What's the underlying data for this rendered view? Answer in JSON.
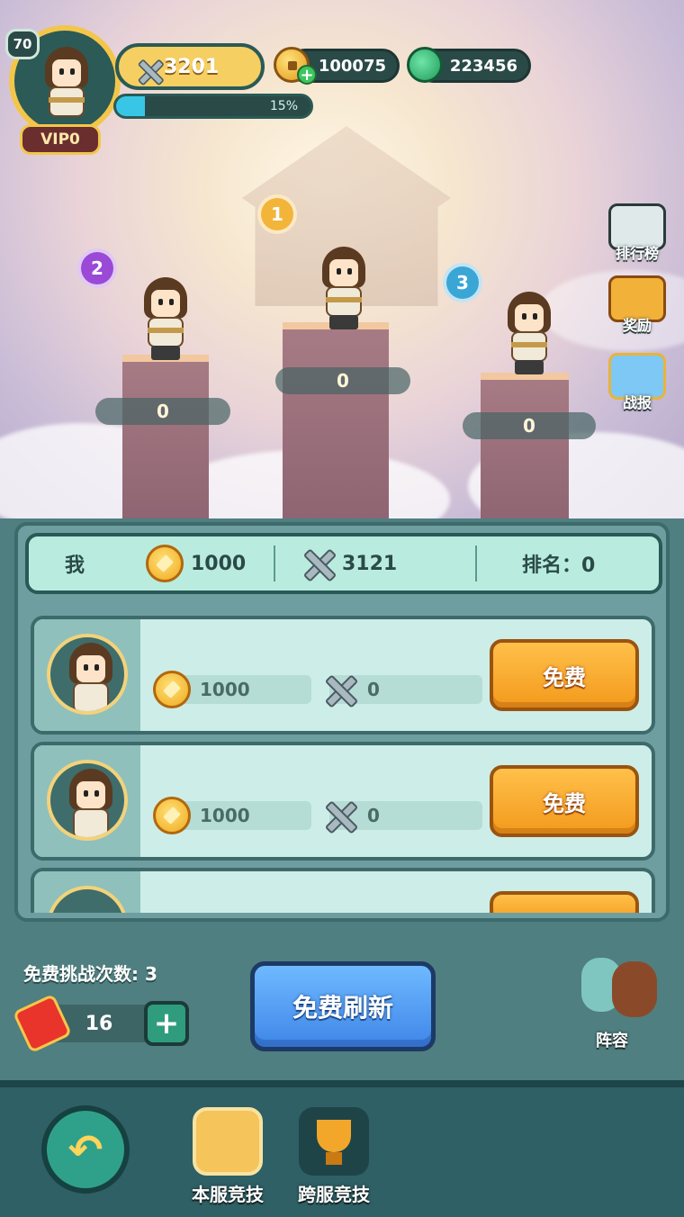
{
  "player": {
    "level": "70",
    "vip": "VIP0",
    "power": "3201",
    "exp_percent": 15,
    "exp_label": "15%",
    "coins": "100075",
    "jade": "223456"
  },
  "podium": [
    {
      "rank": "1",
      "score": "0",
      "badge_color": "#f3b43a"
    },
    {
      "rank": "2",
      "score": "0",
      "badge_color": "#9a4ad6"
    },
    {
      "rank": "3",
      "score": "0",
      "badge_color": "#3aa6d6"
    }
  ],
  "side_menu": {
    "ranking": "排行榜",
    "rewards": "奖励",
    "reports": "战报"
  },
  "me": {
    "label": "我",
    "points": "1000",
    "power": "3121",
    "rank_label": "排名：0"
  },
  "opponents": [
    {
      "points": "1000",
      "power": "0",
      "button": "免费"
    },
    {
      "points": "1000",
      "power": "0",
      "button": "免费"
    }
  ],
  "free_attempts_label": "免费挑战次数: 3",
  "tickets": "16",
  "refresh_button": "免费刷新",
  "lineup_label": "阵容",
  "tabs": {
    "local": "本服竞技",
    "cross": "跨服竞技"
  },
  "colors": {
    "accent_orange": "#f39a1c",
    "accent_blue": "#3f86e8",
    "panel_teal": "#4f7f80"
  }
}
